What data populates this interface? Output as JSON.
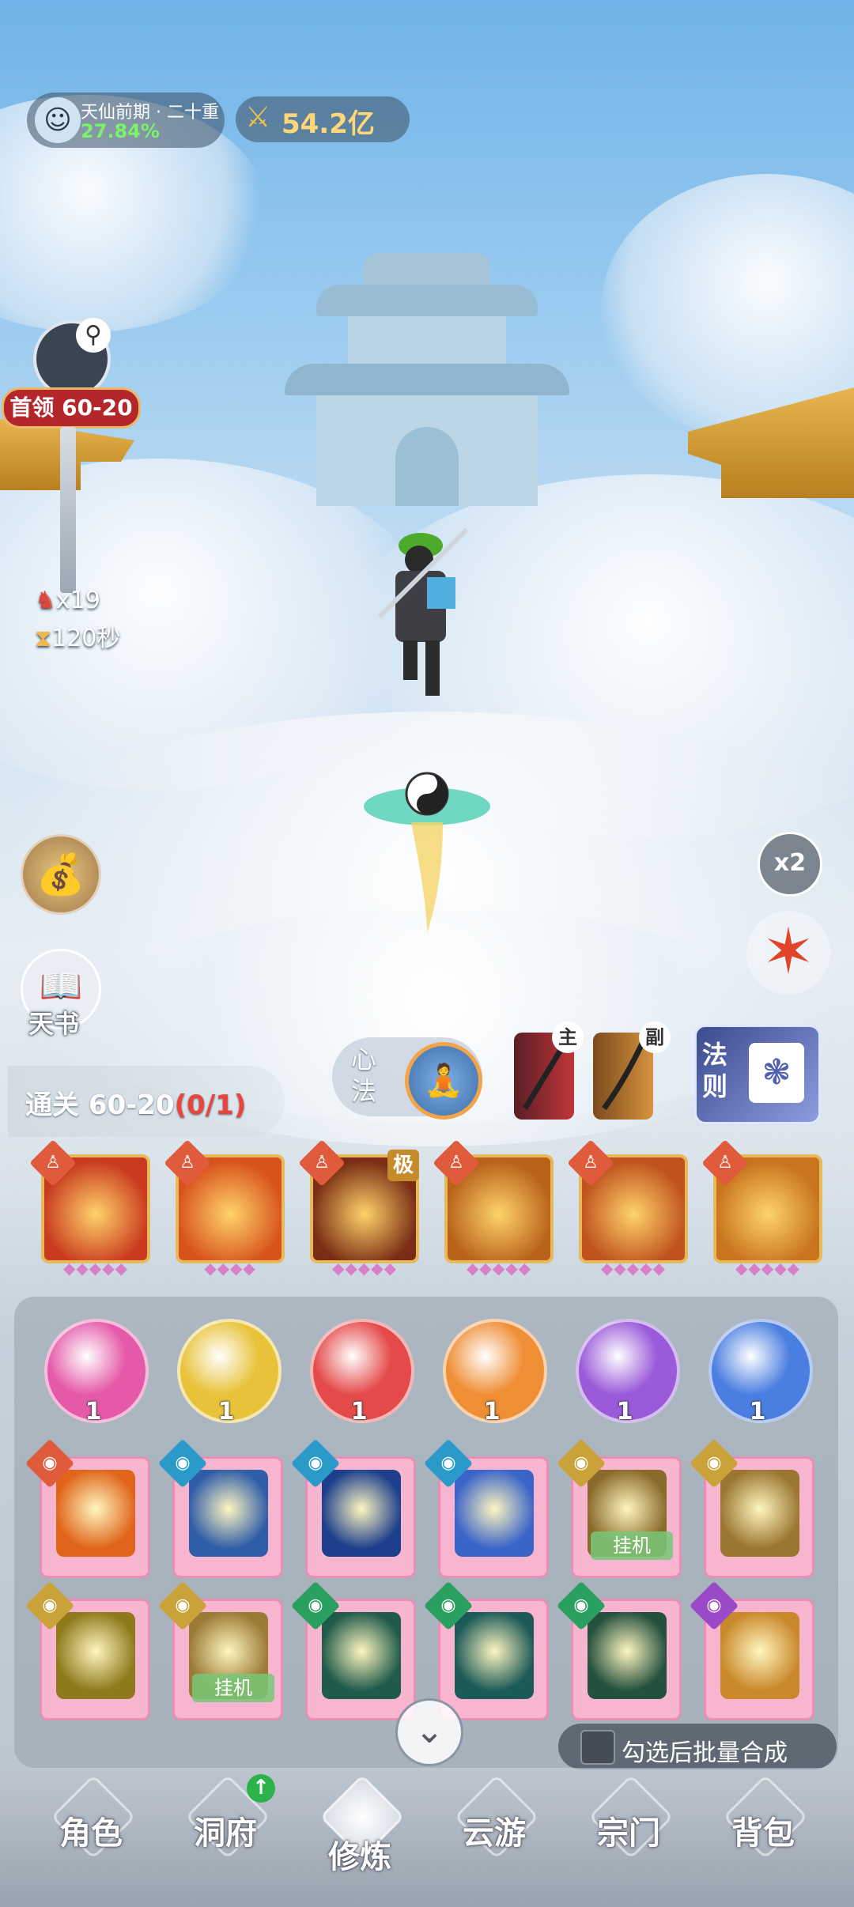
{
  "player": {
    "realm": "天仙前期 · 二十重",
    "progress": "27.84%",
    "power": "54.2亿"
  },
  "boss": {
    "label": "首领 60-20",
    "kills": "x19",
    "timer": "120秒"
  },
  "side": {
    "book_label": "天书",
    "speed_label": "x2"
  },
  "stage": {
    "label": "通关 60-20",
    "progress": "(0/1)"
  },
  "xinfa": {
    "label": "心法"
  },
  "weapons": {
    "main_tag": "主",
    "sub_tag": "副"
  },
  "fa": {
    "label": "法则"
  },
  "skills": [
    {
      "pips": "◆◆◆◆◆",
      "color": "#c93a1f"
    },
    {
      "pips": "◆◆◆◆",
      "color": "#d8531c"
    },
    {
      "pips": "◆◆◆◆◆",
      "color": "#7a2d14",
      "tag": "极"
    },
    {
      "pips": "◆◆◆◆◆",
      "color": "#b8621a"
    },
    {
      "pips": "◆◆◆◆◆",
      "color": "#c0521e"
    },
    {
      "pips": "◆◆◆◆◆",
      "color": "#c8741c"
    }
  ],
  "orbs": [
    {
      "count": "1",
      "color": "#e55aa8"
    },
    {
      "count": "1",
      "color": "#e8c33a"
    },
    {
      "count": "1",
      "color": "#e54a4a"
    },
    {
      "count": "1",
      "color": "#ef8e35"
    },
    {
      "count": "1",
      "color": "#9a5ad9"
    },
    {
      "count": "1",
      "color": "#4a7ee0"
    }
  ],
  "cards_row1": [
    {
      "badge": "#e05b3c",
      "inner": "#e0651a"
    },
    {
      "badge": "#2a9bc9",
      "inner": "#2f5da8"
    },
    {
      "badge": "#2a9bc9",
      "inner": "#1d3f8c"
    },
    {
      "badge": "#2a9bc9",
      "inner": "#3a64c8"
    },
    {
      "badge": "#c9a23a",
      "inner": "#8a6a2a",
      "guaji": "挂机"
    },
    {
      "badge": "#c9a23a",
      "inner": "#9a7630"
    }
  ],
  "cards_row2": [
    {
      "badge": "#c9a23a",
      "inner": "#8e7a1c"
    },
    {
      "badge": "#c9a23a",
      "inner": "#9a7a34",
      "guaji": "挂机"
    },
    {
      "badge": "#2aa060",
      "inner": "#1f5a4a"
    },
    {
      "badge": "#2aa060",
      "inner": "#1c5a58"
    },
    {
      "badge": "#2aa060",
      "inner": "#24503e"
    },
    {
      "badge": "#9a4ac9",
      "inner": "#c9882a"
    }
  ],
  "batch_label": "勾选后批量合成",
  "nav": [
    "角色",
    "洞府",
    "修炼",
    "云游",
    "宗门",
    "背包"
  ]
}
